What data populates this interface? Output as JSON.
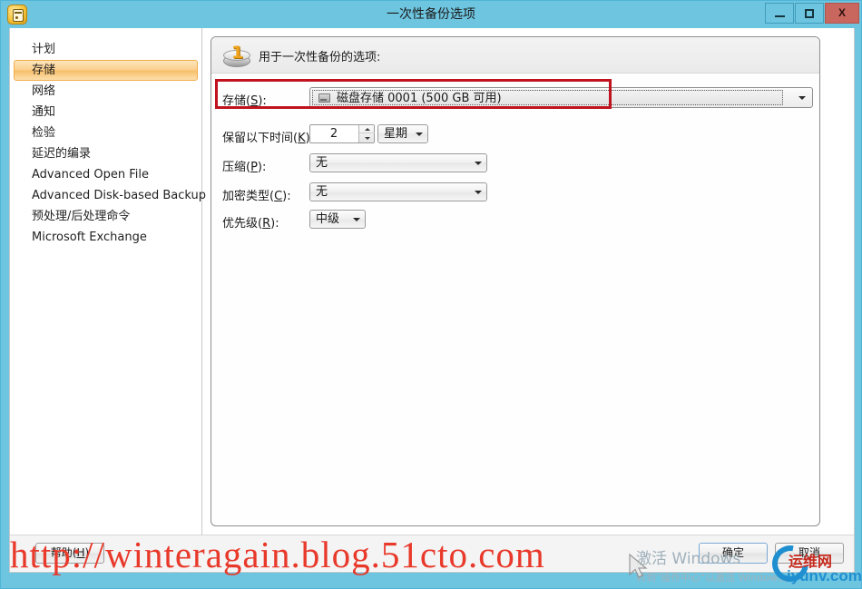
{
  "window": {
    "title": "一次性备份选项",
    "app_icon": "backup-device-icon",
    "controls": {
      "minimize": "minimize-icon",
      "maximize": "maximize-icon",
      "close": "X"
    }
  },
  "sidebar": {
    "items": [
      {
        "label": "计划",
        "selected": false
      },
      {
        "label": "存储",
        "selected": true
      },
      {
        "label": "网络",
        "selected": false
      },
      {
        "label": "通知",
        "selected": false
      },
      {
        "label": "检验",
        "selected": false
      },
      {
        "label": "延迟的编录",
        "selected": false
      },
      {
        "label": "Advanced Open File",
        "selected": false
      },
      {
        "label": "Advanced Disk-based Backup",
        "selected": false
      },
      {
        "label": "预处理/后处理命令",
        "selected": false
      },
      {
        "label": "Microsoft Exchange",
        "selected": false
      }
    ]
  },
  "panel": {
    "icon": "one-time-backup-disc-icon",
    "title": "用于一次性备份的选项:",
    "fields": {
      "storage": {
        "label": "存储(S):",
        "label_main": "存储(",
        "label_key": "S",
        "label_tail": "):",
        "value": "磁盘存储 0001 (500 GB 可用)",
        "icon": "disk-drive-icon",
        "highlighted": true,
        "highlight_color": "#c1121f"
      },
      "retention": {
        "label_main": "保留以下时间(",
        "label_key": "K",
        "label_tail": "):",
        "value": "2",
        "unit": "星期"
      },
      "compression": {
        "label_main": "压缩(",
        "label_key": "P",
        "label_tail": "):",
        "value": "无"
      },
      "encryption": {
        "label_main": "加密类型(",
        "label_key": "C",
        "label_tail": "):",
        "value": "无"
      },
      "priority": {
        "label_main": "优先级(",
        "label_key": "R",
        "label_tail": "):",
        "value": "中级"
      }
    }
  },
  "buttons": {
    "help_main": "帮助(",
    "help_key": "H",
    "help_tail": ")",
    "ok": "确定",
    "cancel": "取消"
  },
  "watermarks": {
    "url": "http://winteragain.blog.51cto.com",
    "activate_line1": "激活 Windows",
    "activate_line2": "转到\"操作中心\"以激活 Windows。",
    "logo_cn": "运维网",
    "logo_en": "iyunv.com"
  }
}
